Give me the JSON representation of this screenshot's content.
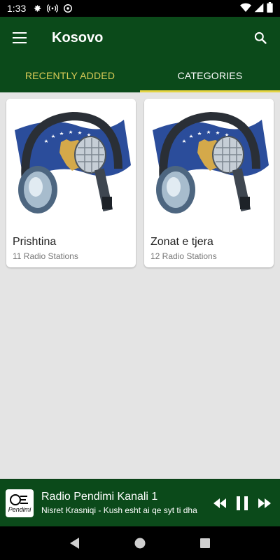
{
  "status_bar": {
    "time": "1:33",
    "icons": [
      "gear-icon",
      "broadcast-icon",
      "at-icon",
      "wifi-icon",
      "signal-icon",
      "battery-icon"
    ]
  },
  "app_bar": {
    "title": "Kosovo",
    "menu_icon": "hamburger-menu-icon",
    "search_icon": "search-icon"
  },
  "tabs": [
    {
      "label": "RECENTLY ADDED",
      "active": false
    },
    {
      "label": "CATEGORIES",
      "active": true
    }
  ],
  "categories": [
    {
      "name": "Prishtina",
      "count": "11 Radio Stations",
      "image": "kosovo-flag-headphones-microphone"
    },
    {
      "name": "Zonat e tjera",
      "count": "12 Radio Stations",
      "image": "kosovo-flag-headphones-microphone"
    }
  ],
  "player": {
    "station": "Radio Pendimi Kanali 1",
    "track": "Nisret Krasniqi - Kush esht ai qe syt ti dha",
    "logo_text": "Pendimi",
    "controls": [
      "rewind-icon",
      "pause-icon",
      "fast-forward-icon"
    ]
  },
  "colors": {
    "primary": "#0b4a1a",
    "accent": "#e4d443",
    "inactive_tab": "#d9cc57",
    "background": "#e4e4e4"
  }
}
